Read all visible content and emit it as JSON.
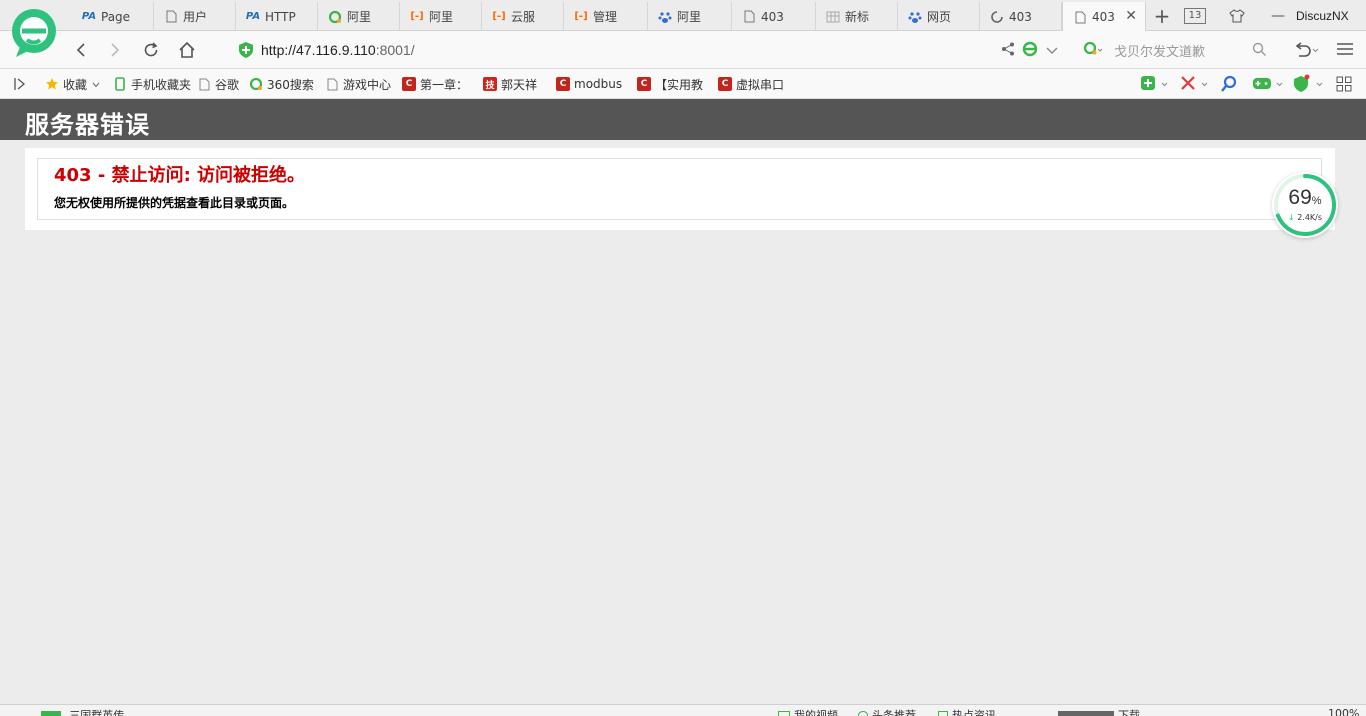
{
  "browser": {
    "tabs": [
      {
        "icon": "pa-icon",
        "glyph": "PA",
        "label": "Page"
      },
      {
        "icon": "page-icon",
        "glyph": "",
        "label": "用户"
      },
      {
        "icon": "pa-icon",
        "glyph": "PA",
        "label": "HTTP"
      },
      {
        "icon": "360-search-icon",
        "glyph": "",
        "label": "阿里"
      },
      {
        "icon": "aliyun-icon",
        "glyph": "[-]",
        "label": "阿里"
      },
      {
        "icon": "aliyun-icon",
        "glyph": "[-]",
        "label": "云服"
      },
      {
        "icon": "aliyun-icon",
        "glyph": "[-]",
        "label": "管理"
      },
      {
        "icon": "baidu-paw-icon",
        "glyph": "",
        "label": "阿里"
      },
      {
        "icon": "page-icon",
        "glyph": "",
        "label": "403"
      },
      {
        "icon": "grid-page-icon",
        "glyph": "",
        "label": "新标"
      },
      {
        "icon": "baidu-paw-icon",
        "glyph": "",
        "label": "网页"
      },
      {
        "icon": "spinner-icon",
        "glyph": "",
        "label": "403"
      },
      {
        "icon": "page-icon",
        "glyph": "",
        "label": "403",
        "active": true
      }
    ],
    "tab_count": "13",
    "window_title_fragment": "DiscuzNX",
    "address": {
      "host": "http://47.116.9.110",
      "port": ":8001/"
    },
    "search_placeholder": "戈贝尔发文道歉",
    "bookmarks": [
      {
        "icon": "star-icon",
        "label": "收藏"
      },
      {
        "icon": "mobile-icon",
        "label": "手机收藏夹"
      },
      {
        "icon": "page-icon",
        "label": "谷歌"
      },
      {
        "icon": "360-search-icon",
        "label": "360搜索"
      },
      {
        "icon": "page-icon",
        "label": "游戏中心"
      },
      {
        "icon": "csdn-icon",
        "label": "第一章："
      },
      {
        "icon": "red-seal-icon",
        "label": "郭天祥"
      },
      {
        "icon": "csdn-icon",
        "label": "modbus"
      },
      {
        "icon": "csdn-icon",
        "label": "【实用教"
      },
      {
        "icon": "csdn-icon",
        "label": "虚拟串口"
      }
    ],
    "speed_widget": {
      "percent": "69",
      "percent_unit": "%",
      "rate": "2.4K/s"
    },
    "statusbar": {
      "left_item": "三国群英传",
      "items": [
        "我的视频",
        "头条推荐",
        "热点资讯",
        "下载"
      ],
      "zoom": "100%"
    }
  },
  "page": {
    "header_title": "服务器错误",
    "error_title": "403 - 禁止访问: 访问被拒绝。",
    "error_message": "您无权使用所提供的凭据查看此目录或页面。"
  },
  "colors": {
    "header_bg": "#555555",
    "error_red": "#cc0000",
    "page_bg": "#ececec",
    "brand_green": "#2ec27e"
  }
}
